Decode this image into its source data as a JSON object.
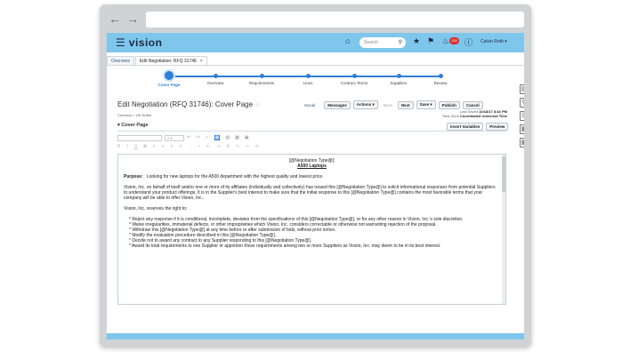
{
  "app": {
    "logo": "vision",
    "user": "Calvin Roth",
    "search_placeholder": "Search",
    "notification_count": "130"
  },
  "tabs": [
    {
      "label": "Overview"
    },
    {
      "label": "Edit Negotiation: RFQ 31746"
    }
  ],
  "train": [
    {
      "label": "Cover Page",
      "current": true
    },
    {
      "label": "Overview"
    },
    {
      "label": "Requirements"
    },
    {
      "label": "Lines"
    },
    {
      "label": "Contract Terms"
    },
    {
      "label": "Suppliers"
    },
    {
      "label": "Review"
    }
  ],
  "page": {
    "title": "Edit Negotiation (RFQ 31746): Cover Page",
    "currency": "Currency = US Dollar",
    "social": "Social",
    "buttons": {
      "messages": "Messages",
      "actions": "Actions ▾",
      "back": "Back",
      "next": "Next",
      "save": "Save ▾",
      "publish": "Publish",
      "cancel": "Cancel"
    },
    "last_saved_label": "Last Saved",
    "last_saved_value": "10/18/17 8:32 PM",
    "time_zone_label": "Time Zone",
    "time_zone_value": "Coordinated Universal Time"
  },
  "section": {
    "title": "Cover Page",
    "insert_variables": "Insert Variables",
    "preview": "Preview"
  },
  "editor": {
    "heading1": "[@Negotiation Type@]:",
    "heading2": "A500 Laptops",
    "purpose_label": "Purpose:",
    "purpose_text": "Looking for new laptops for the A500 department with the highest quality and lowest price.",
    "para1": "Vision, Inc. on behalf of itself and/or one or more of its affiliates (individually and collectively) has issued this [@Negotiation Type@] to solicit informational responses from potential Suppliers to understand your product offerings. It is in the Supplier's best interest to make sure that the initial response to this [@Negotiation Type@] contains the most favorable terms that your company will be able to offer Vision, Inc..",
    "para2": "Vision, Inc. reserves the right to:",
    "bullets": [
      "* Reject any response if it is conditional, incomplete, deviates from the specifications of this [@Negotiation Type@], or for any other reason in Vision, Inc.'s sole discretion.",
      "* Waive irregularities, immaterial defects, or other improprieties which Vision, Inc. considers correctable or otherwise not warranting rejection of the proposal.",
      "* Withdraw this [@Negotiation Type@] at any time before or after submission of bids, without prior notice.",
      "* Modify the evaluation procedure described in this [@Negotiation Type@].",
      "* Decide not to award any contract to any Supplier responding to this [@Negotiation Type@].",
      "* Award its total requirements to one Supplier or apportion those requirements among two or more Suppliers as Vision, Inc. may deem to be in its best interest."
    ]
  },
  "colors": {
    "appbar": "#7fc6ec",
    "accent": "#2f7ed8"
  }
}
